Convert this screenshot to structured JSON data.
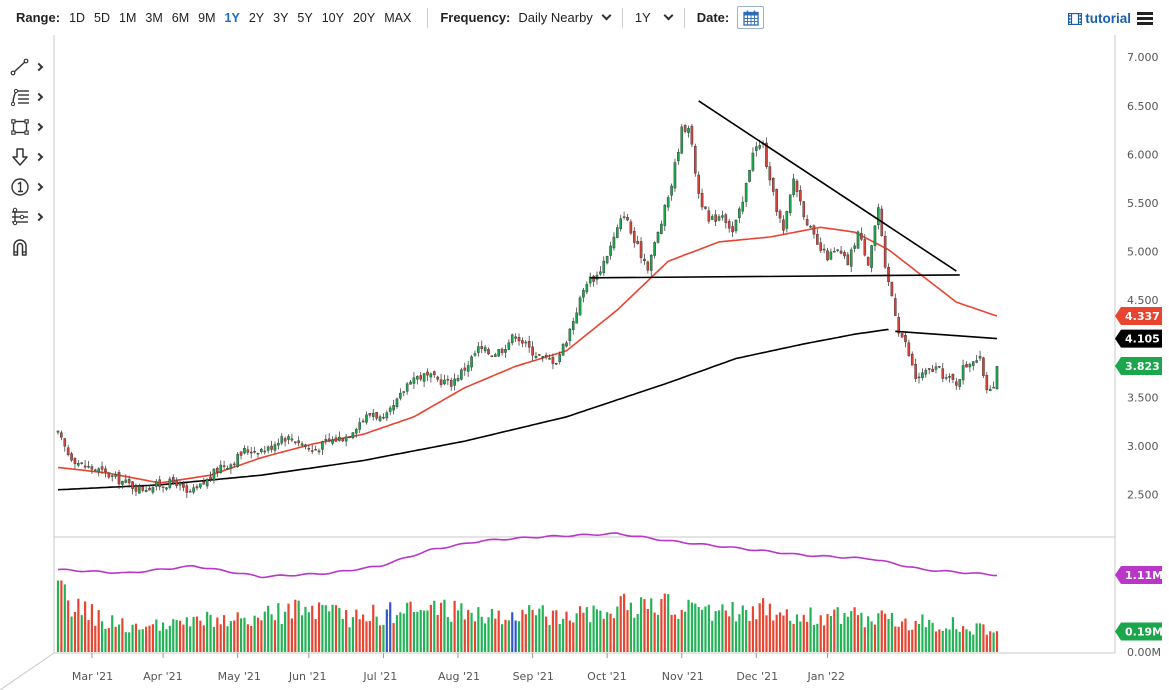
{
  "toolbar": {
    "range_label": "Range:",
    "ranges": [
      "1D",
      "5D",
      "1M",
      "3M",
      "6M",
      "9M",
      "1Y",
      "2Y",
      "3Y",
      "5Y",
      "10Y",
      "20Y",
      "MAX"
    ],
    "active_range": "1Y",
    "frequency_label": "Frequency:",
    "frequency_value": "Daily Nearby",
    "period_value": "1Y",
    "date_label": "Date:",
    "tutorial_label": "tutorial"
  },
  "sidebar_tools": [
    {
      "icon": "line-tool-icon"
    },
    {
      "icon": "fibonacci-tool-icon"
    },
    {
      "icon": "rectangle-tool-icon"
    },
    {
      "icon": "arrow-down-tool-icon"
    },
    {
      "icon": "number-marker-icon"
    },
    {
      "icon": "measure-tool-icon"
    },
    {
      "icon": "magnet-icon"
    }
  ],
  "colors": {
    "up": "#1ca64b",
    "down": "#d0443a",
    "ma_short": "#e8442f",
    "ma_long": "#000000",
    "indicator": "#b936c9",
    "volume_up": "#22b357",
    "volume_down": "#e8442f",
    "volume_highlight": "#2f57c9",
    "price_tag": "#1ca64b",
    "grid": "#e6e6e6"
  },
  "chart_data": {
    "type": "candlestick",
    "x_ticks": [
      "Mar '21",
      "Apr '21",
      "May '21",
      "Jun '21",
      "Jul '21",
      "Aug '21",
      "Sep '21",
      "Oct '21",
      "Nov '21",
      "Dec '21",
      "Jan '22"
    ],
    "y_ticks": [
      "7.000",
      "6.500",
      "6.000",
      "5.500",
      "5.000",
      "4.500",
      "3.500",
      "3.000",
      "2.500"
    ],
    "ylim": [
      2.0,
      7.0
    ],
    "grid": false,
    "close_anchors": [
      [
        0,
        3.12
      ],
      [
        3,
        2.92
      ],
      [
        7,
        2.8
      ],
      [
        12,
        2.75
      ],
      [
        18,
        2.65
      ],
      [
        24,
        2.56
      ],
      [
        30,
        2.6
      ],
      [
        35,
        2.63
      ],
      [
        38,
        2.5
      ],
      [
        41,
        2.55
      ],
      [
        45,
        2.68
      ],
      [
        48,
        2.8
      ],
      [
        51,
        2.82
      ],
      [
        55,
        2.95
      ],
      [
        62,
        2.97
      ],
      [
        66,
        3.1
      ],
      [
        71,
        3.05
      ],
      [
        75,
        2.95
      ],
      [
        80,
        3.05
      ],
      [
        85,
        3.1
      ],
      [
        89,
        3.25
      ],
      [
        93,
        3.35
      ],
      [
        96,
        3.25
      ],
      [
        100,
        3.45
      ],
      [
        104,
        3.7
      ],
      [
        108,
        3.72
      ],
      [
        112,
        3.68
      ],
      [
        116,
        3.65
      ],
      [
        120,
        3.8
      ],
      [
        124,
        4.0
      ],
      [
        128,
        3.95
      ],
      [
        131,
        4.0
      ],
      [
        135,
        4.15
      ],
      [
        139,
        4.0
      ],
      [
        143,
        3.9
      ],
      [
        147,
        3.88
      ],
      [
        150,
        4.1
      ],
      [
        153,
        4.4
      ],
      [
        156,
        4.7
      ],
      [
        159,
        4.75
      ],
      [
        163,
        5.05
      ],
      [
        167,
        5.4
      ],
      [
        170,
        5.1
      ],
      [
        174,
        4.85
      ],
      [
        178,
        5.3
      ],
      [
        181,
        5.7
      ],
      [
        184,
        6.25
      ],
      [
        186,
        6.3
      ],
      [
        189,
        5.6
      ],
      [
        192,
        5.3
      ],
      [
        196,
        5.4
      ],
      [
        199,
        5.2
      ],
      [
        202,
        5.5
      ],
      [
        205,
        6.05
      ],
      [
        208,
        6.1
      ],
      [
        210,
        5.7
      ],
      [
        214,
        5.2
      ],
      [
        217,
        5.75
      ],
      [
        220,
        5.4
      ],
      [
        224,
        5.05
      ],
      [
        227,
        4.95
      ],
      [
        230,
        5.0
      ],
      [
        233,
        4.88
      ],
      [
        236,
        5.2
      ],
      [
        239,
        4.9
      ],
      [
        242,
        5.45
      ],
      [
        244,
        4.8
      ],
      [
        246,
        4.55
      ],
      [
        248,
        4.2
      ],
      [
        250,
        4.05
      ],
      [
        253,
        3.7
      ],
      [
        256,
        3.75
      ],
      [
        259,
        3.8
      ],
      [
        262,
        3.7
      ],
      [
        265,
        3.65
      ],
      [
        267,
        3.8
      ],
      [
        270,
        3.9
      ],
      [
        272,
        3.88
      ],
      [
        274,
        3.6
      ],
      [
        276,
        3.65
      ],
      [
        277,
        3.82
      ]
    ],
    "series": [
      {
        "name": "",
        "type": "moving-average-short",
        "points": [
          [
            0,
            2.78
          ],
          [
            15,
            2.72
          ],
          [
            30,
            2.62
          ],
          [
            45,
            2.7
          ],
          [
            60,
            2.88
          ],
          [
            75,
            3.02
          ],
          [
            90,
            3.12
          ],
          [
            105,
            3.3
          ],
          [
            120,
            3.6
          ],
          [
            135,
            3.82
          ],
          [
            150,
            3.98
          ],
          [
            165,
            4.4
          ],
          [
            180,
            4.9
          ],
          [
            195,
            5.1
          ],
          [
            210,
            5.15
          ],
          [
            225,
            5.25
          ],
          [
            235,
            5.2
          ],
          [
            245,
            5.02
          ],
          [
            255,
            4.75
          ],
          [
            265,
            4.48
          ],
          [
            277,
            4.337
          ]
        ]
      },
      {
        "name": "",
        "type": "moving-average-long",
        "points": [
          [
            0,
            2.55
          ],
          [
            30,
            2.6
          ],
          [
            60,
            2.7
          ],
          [
            90,
            2.85
          ],
          [
            120,
            3.05
          ],
          [
            150,
            3.3
          ],
          [
            180,
            3.65
          ],
          [
            200,
            3.9
          ],
          [
            220,
            4.05
          ],
          [
            235,
            4.15
          ],
          [
            245,
            4.2
          ]
        ]
      }
    ],
    "trendlines": [
      {
        "from": [
          189,
          6.55
        ],
        "to": [
          265,
          4.8
        ]
      },
      {
        "from": [
          157,
          4.73
        ],
        "to": [
          266,
          4.76
        ]
      },
      {
        "from": [
          247,
          4.18
        ],
        "to": [
          277,
          4.105
        ]
      }
    ],
    "price_tags": [
      {
        "value": "4.337",
        "level": 4.337,
        "color": "#e8442f",
        "text_color": "#ffffff"
      },
      {
        "value": "4.105",
        "level": 4.105,
        "color": "#000000",
        "text_color": "#ffffff"
      },
      {
        "value": "3.823",
        "level": 3.823,
        "color": "#1ca64b",
        "text_color": "#ffffff"
      }
    ],
    "indicator_panel": {
      "tag": "1.11M",
      "points": [
        [
          0,
          1.14
        ],
        [
          20,
          1.12
        ],
        [
          40,
          1.16
        ],
        [
          60,
          1.1
        ],
        [
          80,
          1.12
        ],
        [
          95,
          1.16
        ],
        [
          110,
          1.25
        ],
        [
          125,
          1.3
        ],
        [
          140,
          1.32
        ],
        [
          165,
          1.34
        ],
        [
          180,
          1.3
        ],
        [
          200,
          1.26
        ],
        [
          220,
          1.22
        ],
        [
          240,
          1.2
        ],
        [
          255,
          1.14
        ],
        [
          277,
          1.11
        ]
      ]
    },
    "volume_panel": {
      "tag": "0.19M",
      "y_tick": "0.00M",
      "anchors": [
        [
          0,
          0.55
        ],
        [
          5,
          0.42
        ],
        [
          15,
          0.28
        ],
        [
          25,
          0.22
        ],
        [
          35,
          0.25
        ],
        [
          45,
          0.3
        ],
        [
          55,
          0.28
        ],
        [
          70,
          0.4
        ],
        [
          85,
          0.32
        ],
        [
          100,
          0.36
        ],
        [
          115,
          0.4
        ],
        [
          130,
          0.32
        ],
        [
          145,
          0.35
        ],
        [
          160,
          0.4
        ],
        [
          175,
          0.44
        ],
        [
          190,
          0.38
        ],
        [
          205,
          0.4
        ],
        [
          220,
          0.34
        ],
        [
          235,
          0.32
        ],
        [
          250,
          0.28
        ],
        [
          265,
          0.25
        ],
        [
          277,
          0.19
        ]
      ]
    }
  }
}
